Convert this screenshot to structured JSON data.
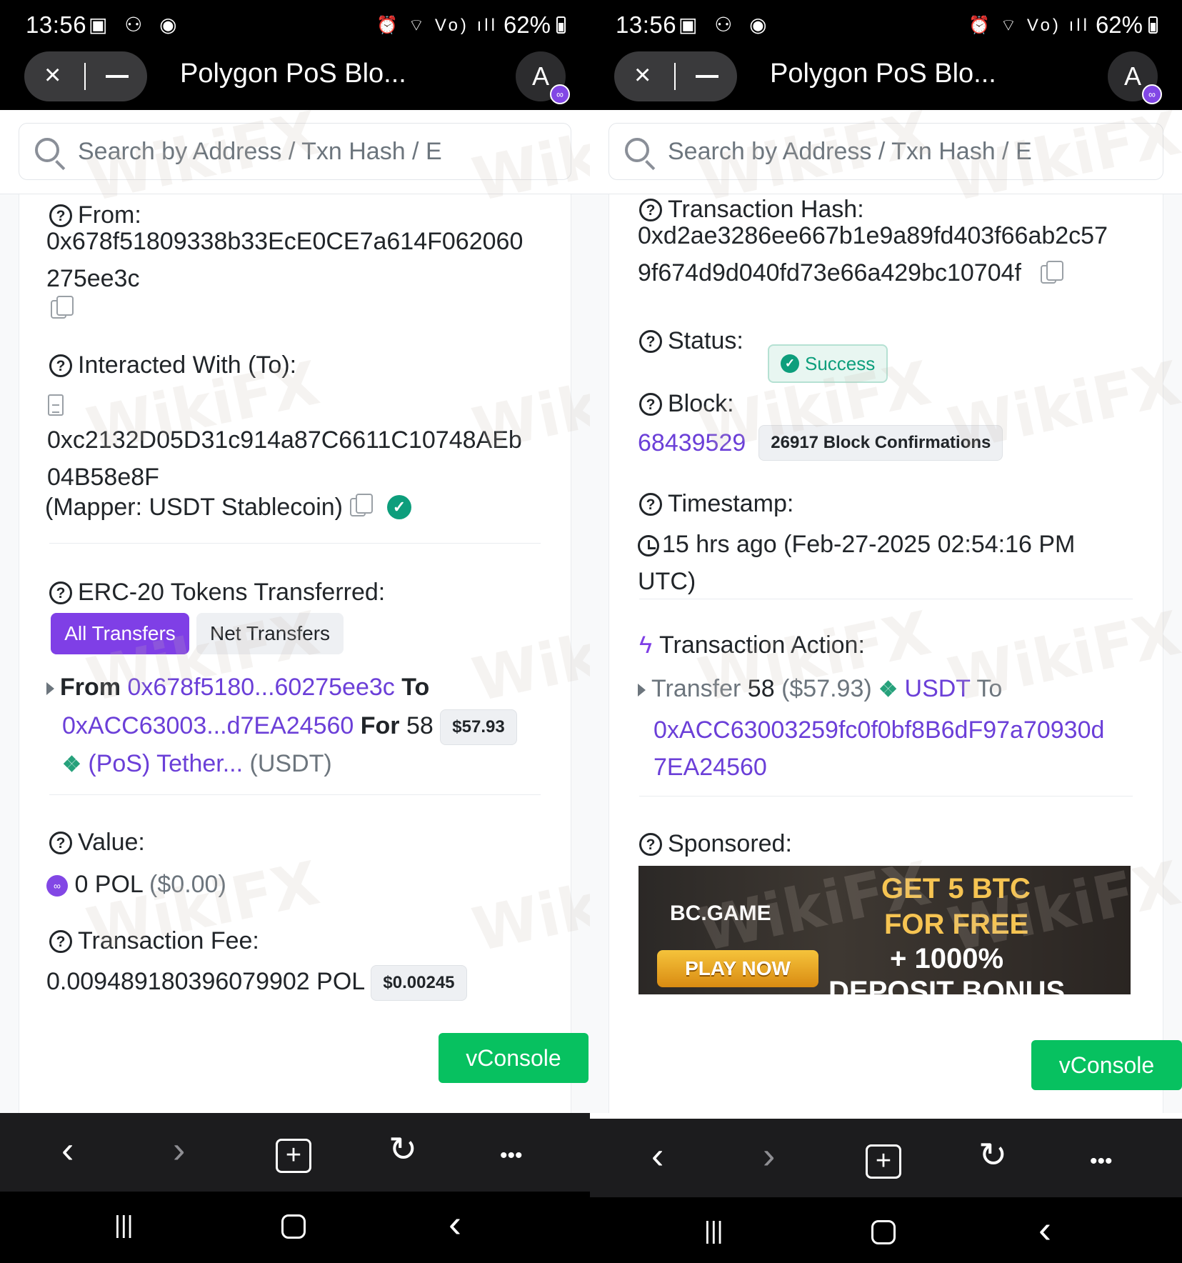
{
  "status_bar": {
    "time": "13:56",
    "battery": "62%",
    "left_icons": "▣ ⚇ ◉",
    "right_icons": "⏰ ⌔ Vo) ıll"
  },
  "browser": {
    "tab_title": "Polygon PoS Blo...",
    "avatar_letter": "A",
    "close_icon": "×"
  },
  "search": {
    "placeholder": "Search by Address / Txn Hash / E"
  },
  "left": {
    "from_label": "From:",
    "from_address_line1": "0x678f51809338b33EcE0CE7a614F062060",
    "from_address_line2": "275ee3c",
    "to_label": "Interacted With (To):",
    "to_address_line1": "0xc2132D05D31c914a87C6611C10748AEb",
    "to_address_line2": "04B58e8F",
    "to_mapper": "(Mapper: USDT Stablecoin)",
    "erc20_label": "ERC-20 Tokens Transferred:",
    "all_transfers": "All Transfers",
    "net_transfers": "Net Transfers",
    "transfer": {
      "from_word": "From",
      "from_addr": "0x678f5180...60275ee3c",
      "to_word": "To",
      "to_addr": "0xACC63003...d7EA24560",
      "for_word": "For",
      "amount": "58",
      "usd": "$57.93",
      "token_name": "(PoS) Tether...",
      "token_symbol": "(USDT)"
    },
    "value_label": "Value:",
    "value_amount": "0 POL",
    "value_usd": "($0.00)",
    "fee_label": "Transaction Fee:",
    "fee_amount": "0.009489180396079902 POL",
    "fee_usd": "$0.00245"
  },
  "right": {
    "hash_label": "Transaction Hash:",
    "hash_line1": "0xd2ae3286ee667b1e9a89fd403f66ab2c57",
    "hash_line2": "9f674d9d040fd73e66a429bc10704f",
    "status_label": "Status:",
    "status_value": "Success",
    "block_label": "Block:",
    "block_number": "68439529",
    "block_confirmations": "26917 Block Confirmations",
    "timestamp_label": "Timestamp:",
    "timestamp_line1": "15 hrs ago (Feb-27-2025 02:54:16 PM",
    "timestamp_line2": "UTC)",
    "action_label": "Transaction Action:",
    "action": {
      "verb": "Transfer",
      "amount": "58",
      "usd": "($57.93)",
      "token": "USDT",
      "to_word": "To",
      "to_line1": "0xACC63003259fc0f0bf8B6dF97a70930d",
      "to_line2": "7EA24560"
    },
    "sponsored_label": "Sponsored:",
    "ad": {
      "brand": "BC.GAME",
      "play": "PLAY NOW",
      "line1": "GET 5 BTC",
      "line2": "FOR FREE",
      "line3": "+ 1000%",
      "line4": "DEPOSIT BONUS"
    }
  },
  "vconsole_label": "vConsole",
  "watermark": "WikiFX",
  "toolbar": {
    "back": "‹",
    "forward": "›",
    "new_tab": "+",
    "reload": "↻",
    "more": "•••"
  },
  "navbar": {
    "recents": "|||",
    "back": "‹"
  },
  "colors": {
    "link": "#6b3fd8",
    "primary": "#7f3fe6",
    "success": "#0d9e7c",
    "vconsole": "#07c160"
  }
}
